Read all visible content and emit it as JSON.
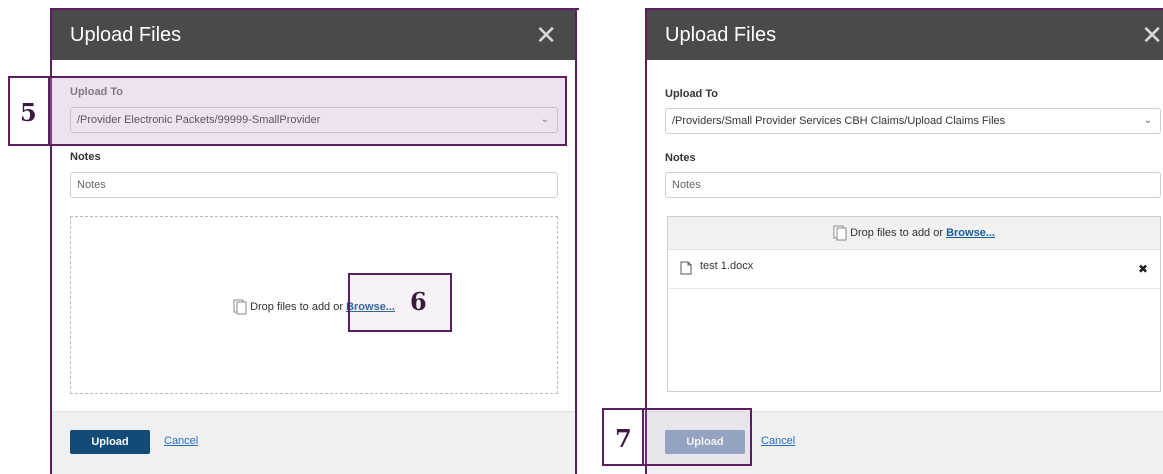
{
  "left_dialog": {
    "title": "Upload Files",
    "close_symbol": "✕",
    "upload_to_label": "Upload To",
    "upload_to_value": "/Provider Electronic Packets/99999-SmallProvider",
    "notes_label": "Notes",
    "notes_placeholder": "Notes",
    "drop_text": "Drop files to add or",
    "browse_text": "Browse...",
    "upload_button": "Upload",
    "cancel_link": "Cancel"
  },
  "right_dialog": {
    "title": "Upload Files",
    "close_symbol": "✕",
    "upload_to_label": "Upload To",
    "upload_to_value": "/Providers/Small Provider Services CBH Claims/Upload Claims Files",
    "notes_label": "Notes",
    "notes_placeholder": "Notes",
    "drop_text": "Drop files to add or",
    "browse_text": "Browse...",
    "files": [
      {
        "name": "test 1.docx",
        "remove_symbol": "✖"
      }
    ],
    "upload_button": "Upload",
    "cancel_link": "Cancel"
  },
  "callouts": {
    "step5": "5",
    "step6": "6",
    "step7": "7"
  },
  "colors": {
    "accent": "#5b1e5e",
    "upload_enabled": "#124a78",
    "upload_disabled": "#8ba4c0",
    "header": "#4a4a4a"
  },
  "icons": {
    "file_icon": "document-icon",
    "drop_icon": "files-drop-icon",
    "close": "close-icon",
    "remove": "remove-x-icon",
    "chevron": "chevron-down-icon"
  }
}
